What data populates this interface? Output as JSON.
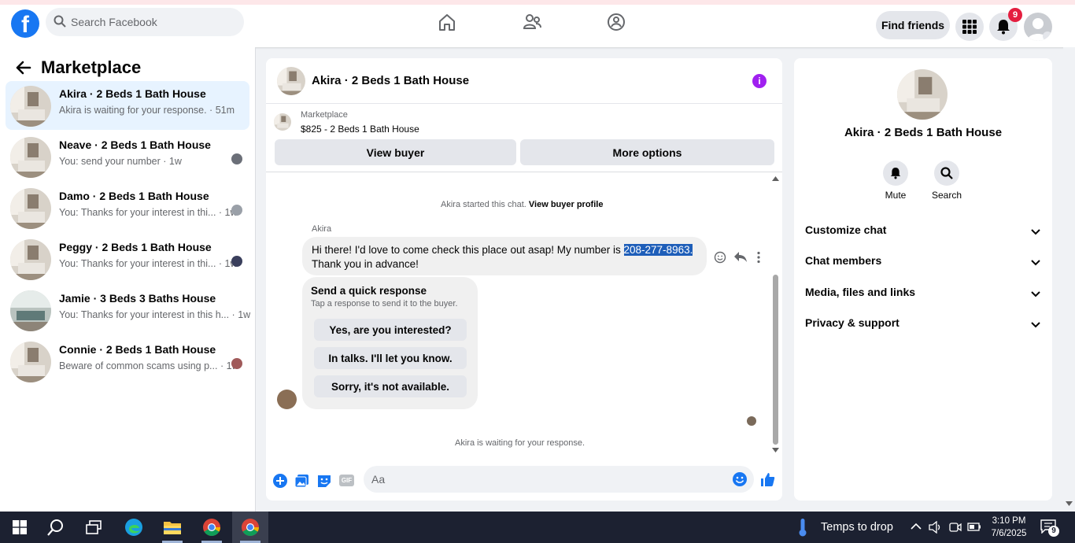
{
  "topbar": {
    "logo_letter": "f",
    "search_placeholder": "Search Facebook",
    "find_friends_label": "Find friends",
    "notification_count": "9"
  },
  "left": {
    "title": "Marketplace",
    "conversations": [
      {
        "name": "Akira · 2 Beds 1 Bath House",
        "snippet": "Akira is waiting for your response. · 51m"
      },
      {
        "name": "Neave · 2 Beds 1 Bath House",
        "snippet": "You: send your number · 1w"
      },
      {
        "name": "Damo · 2 Beds 1 Bath House",
        "snippet": "You: Thanks for your interest in thi... · 1w"
      },
      {
        "name": "Peggy · 2 Beds 1 Bath House",
        "snippet": "You: Thanks for your interest in thi... · 1w"
      },
      {
        "name": "Jamie · 3 Beds 3 Baths House",
        "snippet": "You: Thanks for your interest in this h... · 1w"
      },
      {
        "name": "Connie · 2 Beds 1 Bath House",
        "snippet": "Beware of common scams using p... · 1w"
      }
    ]
  },
  "chat": {
    "title": "Akira · 2 Beds 1 Bath House",
    "info_glyph": "i",
    "marketplace_label": "Marketplace",
    "listing": "$825 - 2 Beds 1 Bath House",
    "view_buyer": "View buyer",
    "more_options": "More options",
    "started_text": "Akira started this chat.",
    "view_profile": "View buyer profile",
    "sender": "Akira",
    "message_before": "Hi there! I'd love to come check this place out asap! My number is ",
    "message_highlight": "208-277-8963.",
    "message_after": "Thank you in advance!",
    "quick_title": "Send a quick response",
    "quick_sub": "Tap a response to send it to the buyer.",
    "quick_responses": [
      "Yes, are you interested?",
      "In talks. I'll let you know.",
      "Sorry, it's not available."
    ],
    "waiting": "Akira is waiting for your response.",
    "input_placeholder": "Aa",
    "gif_label": "GIF"
  },
  "right": {
    "title": "Akira · 2 Beds 1 Bath House",
    "mute": "Mute",
    "search": "Search",
    "sections": [
      "Customize chat",
      "Chat members",
      "Media, files and links",
      "Privacy & support"
    ]
  },
  "taskbar": {
    "weather": "Temps to drop",
    "time": "3:10 PM",
    "date": "7/6/2025",
    "notif_count": "9"
  },
  "colors": {
    "brand_blue": "#1877f2",
    "highlight": "#1e5eb9",
    "active_conversation": "#e7f3ff",
    "badge_red": "#e41e3f",
    "info_purple": "#a020f0"
  }
}
